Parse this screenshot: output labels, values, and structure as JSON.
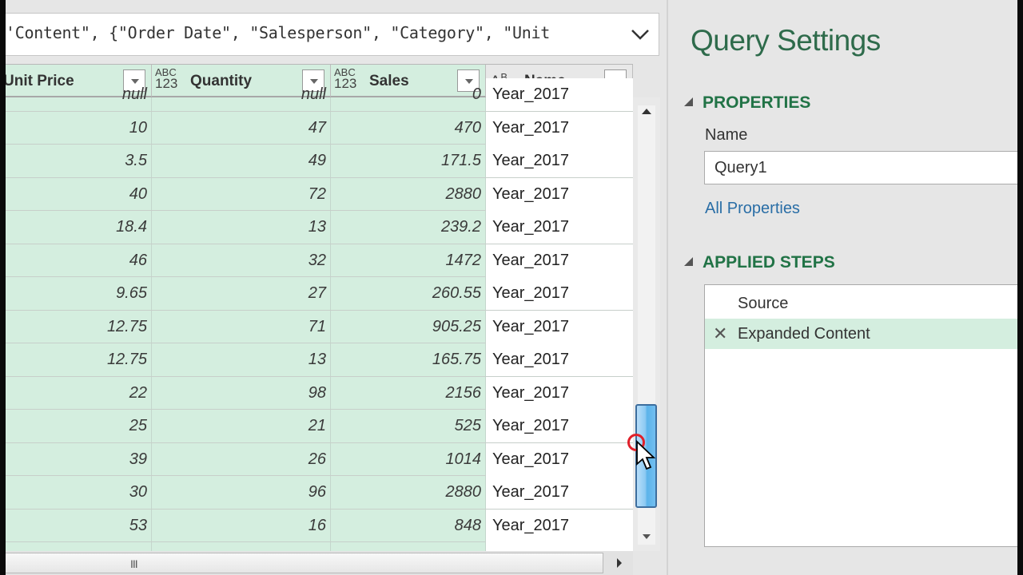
{
  "formula_bar": {
    "text": "'Content\", {\"Order Date\", \"Salesperson\", \"Category\", \"Unit"
  },
  "grid": {
    "columns": [
      {
        "name": "Unit Price",
        "type_icon": ""
      },
      {
        "name": "Quantity",
        "type_icon_top": "ABC",
        "type_icon_bottom": "123"
      },
      {
        "name": "Sales",
        "type_icon_top": "ABC",
        "type_icon_bottom": "123"
      },
      {
        "name": "Name",
        "type_icon_top": "A",
        "type_icon_sup": "B",
        "type_icon_sub": "C"
      }
    ],
    "partial_row": {
      "unit_price": "null",
      "quantity": "null",
      "sales": "0",
      "name": "Year_2017"
    },
    "rows": [
      {
        "unit_price": "10",
        "quantity": "47",
        "sales": "470",
        "name": "Year_2017"
      },
      {
        "unit_price": "3.5",
        "quantity": "49",
        "sales": "171.5",
        "name": "Year_2017"
      },
      {
        "unit_price": "40",
        "quantity": "72",
        "sales": "2880",
        "name": "Year_2017"
      },
      {
        "unit_price": "18.4",
        "quantity": "13",
        "sales": "239.2",
        "name": "Year_2017"
      },
      {
        "unit_price": "46",
        "quantity": "32",
        "sales": "1472",
        "name": "Year_2017"
      },
      {
        "unit_price": "9.65",
        "quantity": "27",
        "sales": "260.55",
        "name": "Year_2017"
      },
      {
        "unit_price": "12.75",
        "quantity": "71",
        "sales": "905.25",
        "name": "Year_2017"
      },
      {
        "unit_price": "12.75",
        "quantity": "13",
        "sales": "165.75",
        "name": "Year_2017"
      },
      {
        "unit_price": "22",
        "quantity": "98",
        "sales": "2156",
        "name": "Year_2017"
      },
      {
        "unit_price": "25",
        "quantity": "21",
        "sales": "525",
        "name": "Year_2017"
      },
      {
        "unit_price": "39",
        "quantity": "26",
        "sales": "1014",
        "name": "Year_2017"
      },
      {
        "unit_price": "30",
        "quantity": "96",
        "sales": "2880",
        "name": "Year_2017"
      },
      {
        "unit_price": "53",
        "quantity": "16",
        "sales": "848",
        "name": "Year_2017"
      }
    ],
    "hscroll_grip": "III"
  },
  "query_settings": {
    "title": "Query Settings",
    "properties_header": "PROPERTIES",
    "name_label": "Name",
    "name_value": "Query1",
    "all_properties_link": "All Properties",
    "applied_steps_header": "APPLIED STEPS",
    "steps": [
      {
        "label": "Source",
        "selected": false
      },
      {
        "label": "Expanded Content",
        "selected": true,
        "delete_icon": "✕"
      }
    ]
  },
  "colors": {
    "accent_green": "#217346",
    "selected_column_bg": "#d4eedf",
    "link_blue": "#2a6ea6",
    "scroll_thumb_blue": "#5bb3ea"
  }
}
